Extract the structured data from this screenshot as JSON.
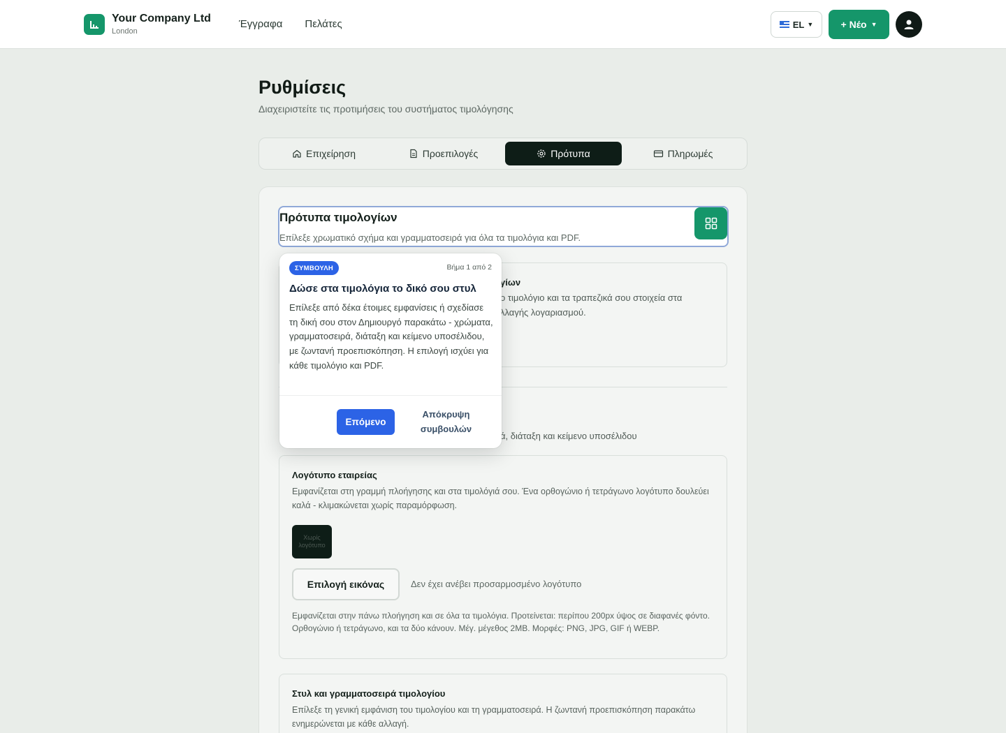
{
  "header": {
    "company_name": "Your Company Ltd",
    "company_city": "London",
    "nav": [
      "Έγγραφα",
      "Πελάτες"
    ],
    "language": "EL",
    "new_button": "+ Νέο"
  },
  "page": {
    "title": "Ρυθμίσεις",
    "subtitle": "Διαχειριστείτε τις προτιμήσεις του συστήματος τιμολόγησης"
  },
  "tabs": [
    {
      "label": "Επιχείρηση",
      "icon": "home-icon"
    },
    {
      "label": "Προεπιλογές",
      "icon": "document-icon"
    },
    {
      "label": "Πρότυπα",
      "icon": "gear-icon",
      "active": true
    },
    {
      "label": "Πληρωμές",
      "icon": "credit-card-icon"
    }
  ],
  "section": {
    "title": "Πρότυπα τιμολογίων",
    "subtitle": "Επίλεξε χρωματικό σχήμα και γραμματοσειρά για όλα τα τιμολόγια και PDF."
  },
  "box1": {
    "title_fragment": "γίων",
    "text_line1": "ο τιμολόγιο και τα τραπεζικά σου στοιχεία στα",
    "text_line2": "λλαγής λογαριασμού."
  },
  "after_divider_text": "ά, διάταξη και κείμενο υποσέλιδου",
  "logo_box": {
    "title": "Λογότυπο εταιρείας",
    "text": "Εμφανίζεται στη γραμμή πλοήγησης και στα τιμολόγιά σου. Ένα ορθογώνιο ή τετράγωνο λογότυπο δουλεύει καλά - κλιμακώνεται χωρίς παραμόρφωση.",
    "placeholder": "Χωρίς λογότυπο",
    "choose_button": "Επιλογή εικόνας",
    "status": "Δεν έχει ανέβει προσαρμοσμένο λογότυπο",
    "note": "Εμφανίζεται στην πάνω πλοήγηση και σε όλα τα τιμολόγια. Προτείνεται: περίπου 200px ύψος σε διαφανές φόντο. Ορθογώνιο ή τετράγωνο, και τα δύο κάνουν. Μέγ. μέγεθος 2MB. Μορφές: PNG, JPG, GIF ή WEBP."
  },
  "style_box": {
    "title": "Στυλ και γραμματοσειρά τιμολογίου",
    "text": "Επίλεξε τη γενική εμφάνιση του τιμολογίου και τη γραμματοσειρά. Η ζωντανή προεπισκόπηση παρακάτω ενημερώνεται με κάθε αλλαγή."
  },
  "tooltip": {
    "badge": "ΣΥΜΒΟΥΛΗ",
    "step": "Βήμα 1 από 2",
    "title": "Δώσε στα τιμολόγια το δικό σου στυλ",
    "body": "Επίλεξε από δέκα έτοιμες εμφανίσεις ή σχεδίασε τη δική σου στον Δημιουργό παρακάτω - χρώματα, γραμματοσειρά, διάταξη και κείμενο υποσέλιδου, με ζωντανή προεπισκόπηση. Η επιλογή ισχύει για κάθε τιμολόγιο και PDF.",
    "next_button": "Επόμενο",
    "hide_button": "Απόκρυψη συμβουλών"
  },
  "colors": {
    "accent": "#15966a",
    "dark": "#0e1d17",
    "tooltip_blue": "#2c63e6"
  }
}
